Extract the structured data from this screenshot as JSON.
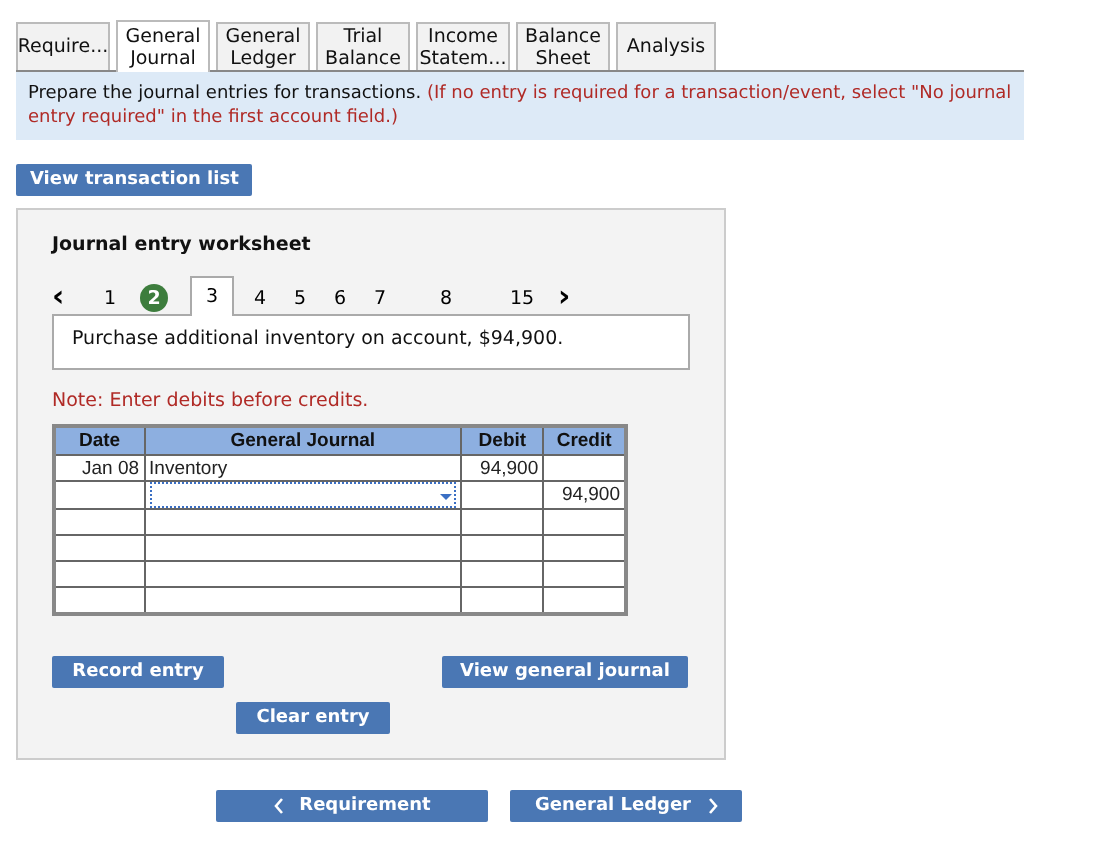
{
  "tabs": [
    {
      "label": "Require...",
      "selected": false
    },
    {
      "label": "General Journal",
      "selected": true
    },
    {
      "label": "General Ledger",
      "selected": false
    },
    {
      "label": "Trial Balance",
      "selected": false
    },
    {
      "label": "Income Statem...",
      "selected": false
    },
    {
      "label": "Balance Sheet",
      "selected": false
    },
    {
      "label": "Analysis",
      "selected": false
    }
  ],
  "instructions": {
    "text": "Prepare the journal entries for transactions.",
    "note": "(If no entry is required for a transaction/event, select \"No journal entry required\" in the first account field.)"
  },
  "view_transaction_list": "View transaction list",
  "worksheet": {
    "title": "Journal entry worksheet",
    "prev": "‹",
    "next": "›",
    "pages": [
      {
        "label": "1",
        "selected": false,
        "completed": false
      },
      {
        "label": "2",
        "selected": false,
        "completed": true
      },
      {
        "label": "3",
        "selected": true,
        "completed": false
      },
      {
        "label": "4",
        "selected": false,
        "completed": false
      },
      {
        "label": "5",
        "selected": false,
        "completed": false
      },
      {
        "label": "6",
        "selected": false,
        "completed": false
      },
      {
        "label": "7",
        "selected": false,
        "completed": false
      },
      {
        "label": "8",
        "selected": false,
        "completed": false
      },
      {
        "label": "15",
        "selected": false,
        "completed": false
      }
    ],
    "description": "Purchase additional inventory on account, $94,900.",
    "note": "Note: Enter debits before credits.",
    "columns": [
      "Date",
      "General Journal",
      "Debit",
      "Credit"
    ],
    "rows": [
      {
        "date": "Jan 08",
        "account": "Inventory",
        "debit": "94,900",
        "credit": "",
        "focused": false
      },
      {
        "date": "",
        "account": "",
        "debit": "",
        "credit": "94,900",
        "focused": true
      },
      {
        "date": "",
        "account": "",
        "debit": "",
        "credit": "",
        "focused": false
      },
      {
        "date": "",
        "account": "",
        "debit": "",
        "credit": "",
        "focused": false
      },
      {
        "date": "",
        "account": "",
        "debit": "",
        "credit": "",
        "focused": false
      },
      {
        "date": "",
        "account": "",
        "debit": "",
        "credit": "",
        "focused": false
      }
    ],
    "record_entry": "Record entry",
    "view_general_journal": "View general journal",
    "clear_entry": "Clear entry"
  },
  "nav": {
    "back": "Requirement",
    "forward": "General Ledger"
  }
}
